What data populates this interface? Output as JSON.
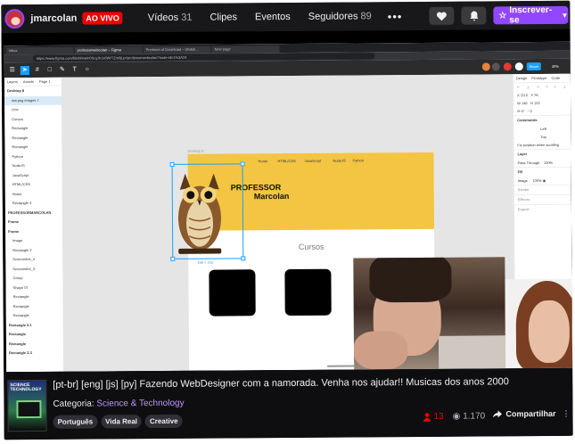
{
  "header": {
    "channel": "jmarcolan",
    "live_badge": "AO VIVO",
    "tabs": [
      {
        "label": "Vídeos",
        "count": "31"
      },
      {
        "label": "Clipes",
        "count": ""
      },
      {
        "label": "Eventos",
        "count": ""
      },
      {
        "label": "Seguidores",
        "count": "89"
      }
    ],
    "more": "•••",
    "subscribe_label": "Inscrever-se"
  },
  "browser": {
    "tabs": [
      "Inbox",
      "professorwebcolan – Figma",
      "Premium of Download – Ubdeb…",
      "New page"
    ],
    "url": "https://www.figma.com/file/hRw0n0SrqJh1x6WrTZm0jLpr/professorwebcolan?node-id=1%3A24"
  },
  "figma": {
    "layers_tabs": [
      "Layers",
      "Assets",
      "Page 1"
    ],
    "layers": [
      {
        "label": "Desktop 8",
        "kind": "frame"
      },
      {
        "label": "ww.png images 7",
        "kind": "sel"
      },
      {
        "label": "Line",
        "kind": ""
      },
      {
        "label": "Cursos",
        "kind": ""
      },
      {
        "label": "Rectangle",
        "kind": ""
      },
      {
        "label": "Rectangle",
        "kind": ""
      },
      {
        "label": "Rectangle",
        "kind": ""
      },
      {
        "label": "Python",
        "kind": ""
      },
      {
        "label": "NodeJS",
        "kind": ""
      },
      {
        "label": "JavaScript",
        "kind": ""
      },
      {
        "label": "HTML/CSS",
        "kind": ""
      },
      {
        "label": "Home",
        "kind": ""
      },
      {
        "label": "Rectangle 4",
        "kind": ""
      },
      {
        "label": "PROFESSORMARCOLAN",
        "kind": "frame"
      },
      {
        "label": "Frame",
        "kind": "frame"
      },
      {
        "label": "Frame",
        "kind": "frame"
      },
      {
        "label": "Image",
        "kind": ""
      },
      {
        "label": "Rectangle 2",
        "kind": ""
      },
      {
        "label": "Screenshot_4",
        "kind": ""
      },
      {
        "label": "Screenshot_3",
        "kind": ""
      },
      {
        "label": "Group",
        "kind": ""
      },
      {
        "label": "Shape 07",
        "kind": ""
      },
      {
        "label": "Rectangle",
        "kind": ""
      },
      {
        "label": "Rectangle",
        "kind": ""
      },
      {
        "label": "Rectangle",
        "kind": ""
      },
      {
        "label": "Rectangle 2.1",
        "kind": "frame"
      },
      {
        "label": "Rectangle",
        "kind": "frame"
      },
      {
        "label": "Rectangle",
        "kind": "frame"
      },
      {
        "label": "Rectangle 2.3",
        "kind": "frame"
      }
    ],
    "frame_label": "Desktop 8",
    "nav": [
      "Home",
      "HTML/CSS",
      "JavaScript",
      "NodeJS",
      "Python"
    ],
    "hero_title_1": "PROFESSOR",
    "hero_title_2": "Marcolan",
    "section_title": "Cursos",
    "selection_size": "166 × 215",
    "share": "Share",
    "zoom": "40%",
    "props_tabs": [
      "Design",
      "Prototype",
      "Code"
    ],
    "props": {
      "x": "X  1115",
      "y": "Y  76",
      "w": "W  146",
      "h": "H  122",
      "rot": "⟳  0°",
      "radius": "◜  0",
      "constraints": "Constraints",
      "left": "Left",
      "top": "Top",
      "fix_scroll": "Fix position when scrolling",
      "layer": "Layer",
      "pass_through": "Pass Through",
      "opacity": "100%",
      "fill": "Fill",
      "image": "Image",
      "image_opacity": "100%",
      "stroke": "Stroke",
      "effects": "Effects",
      "export": "Export"
    }
  },
  "stream": {
    "art_title": "SCIENCE\nTECHNOLOGY",
    "title": "[pt-br] [eng] [js] [py] Fazendo WebDesigner com a namorada. Venha nos ajudar!! Musicas dos anos 2000",
    "category_label": "Categoria:",
    "category": "Science & Technology",
    "tags": [
      "Português",
      "Vida Real",
      "Creative"
    ],
    "viewers": "13",
    "total_views": "1.170",
    "share": "Compartilhar",
    "more": "⋮"
  },
  "colors": {
    "brand_purple": "#9147ff",
    "live_red": "#eb0400",
    "figma_blue": "#18a0fb",
    "hero_yellow": "#f4c542"
  }
}
